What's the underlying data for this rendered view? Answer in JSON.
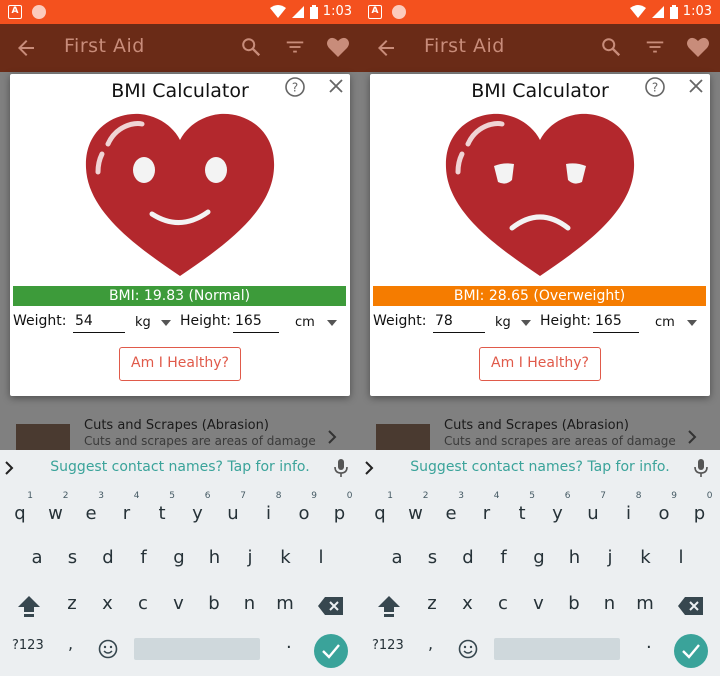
{
  "colors": {
    "accent": "#f4511e",
    "appbar": "#6a2b17",
    "normal": "#3d9b3a",
    "overweight": "#f57c00",
    "button": "#e05a4a",
    "keyboard_accent": "#3aa39a"
  },
  "status_time": "1:03",
  "appbar": {
    "title": "First Aid"
  },
  "list_item": {
    "title": "Cuts and Scrapes (Abrasion)",
    "subtitle": "Cuts and scrapes are areas of damage"
  },
  "suggestion": "Suggest contact names? Tap for info.",
  "dialog": {
    "title": "BMI Calculator",
    "weight_label": "Weight:",
    "height_label": "Height:",
    "weight_unit": "kg",
    "height_unit": "cm",
    "button_label": "Am I Healthy?"
  },
  "screens": [
    {
      "bmi_text": "BMI: 19.83 (Normal)",
      "status": "normal",
      "weight": "54",
      "height": "165"
    },
    {
      "bmi_text": "BMI: 28.65 (Overweight)",
      "status": "overweight",
      "weight": "78",
      "height": "165"
    }
  ],
  "keyboard": {
    "row1": [
      [
        "q",
        "1"
      ],
      [
        "w",
        "2"
      ],
      [
        "e",
        "3"
      ],
      [
        "r",
        "4"
      ],
      [
        "t",
        "5"
      ],
      [
        "y",
        "6"
      ],
      [
        "u",
        "7"
      ],
      [
        "i",
        "8"
      ],
      [
        "o",
        "9"
      ],
      [
        "p",
        "0"
      ]
    ],
    "row2": [
      "a",
      "s",
      "d",
      "f",
      "g",
      "h",
      "j",
      "k",
      "l"
    ],
    "row3": [
      "z",
      "x",
      "c",
      "v",
      "b",
      "n",
      "m"
    ],
    "symbols_label": "?123",
    "comma": ",",
    "period": "."
  }
}
